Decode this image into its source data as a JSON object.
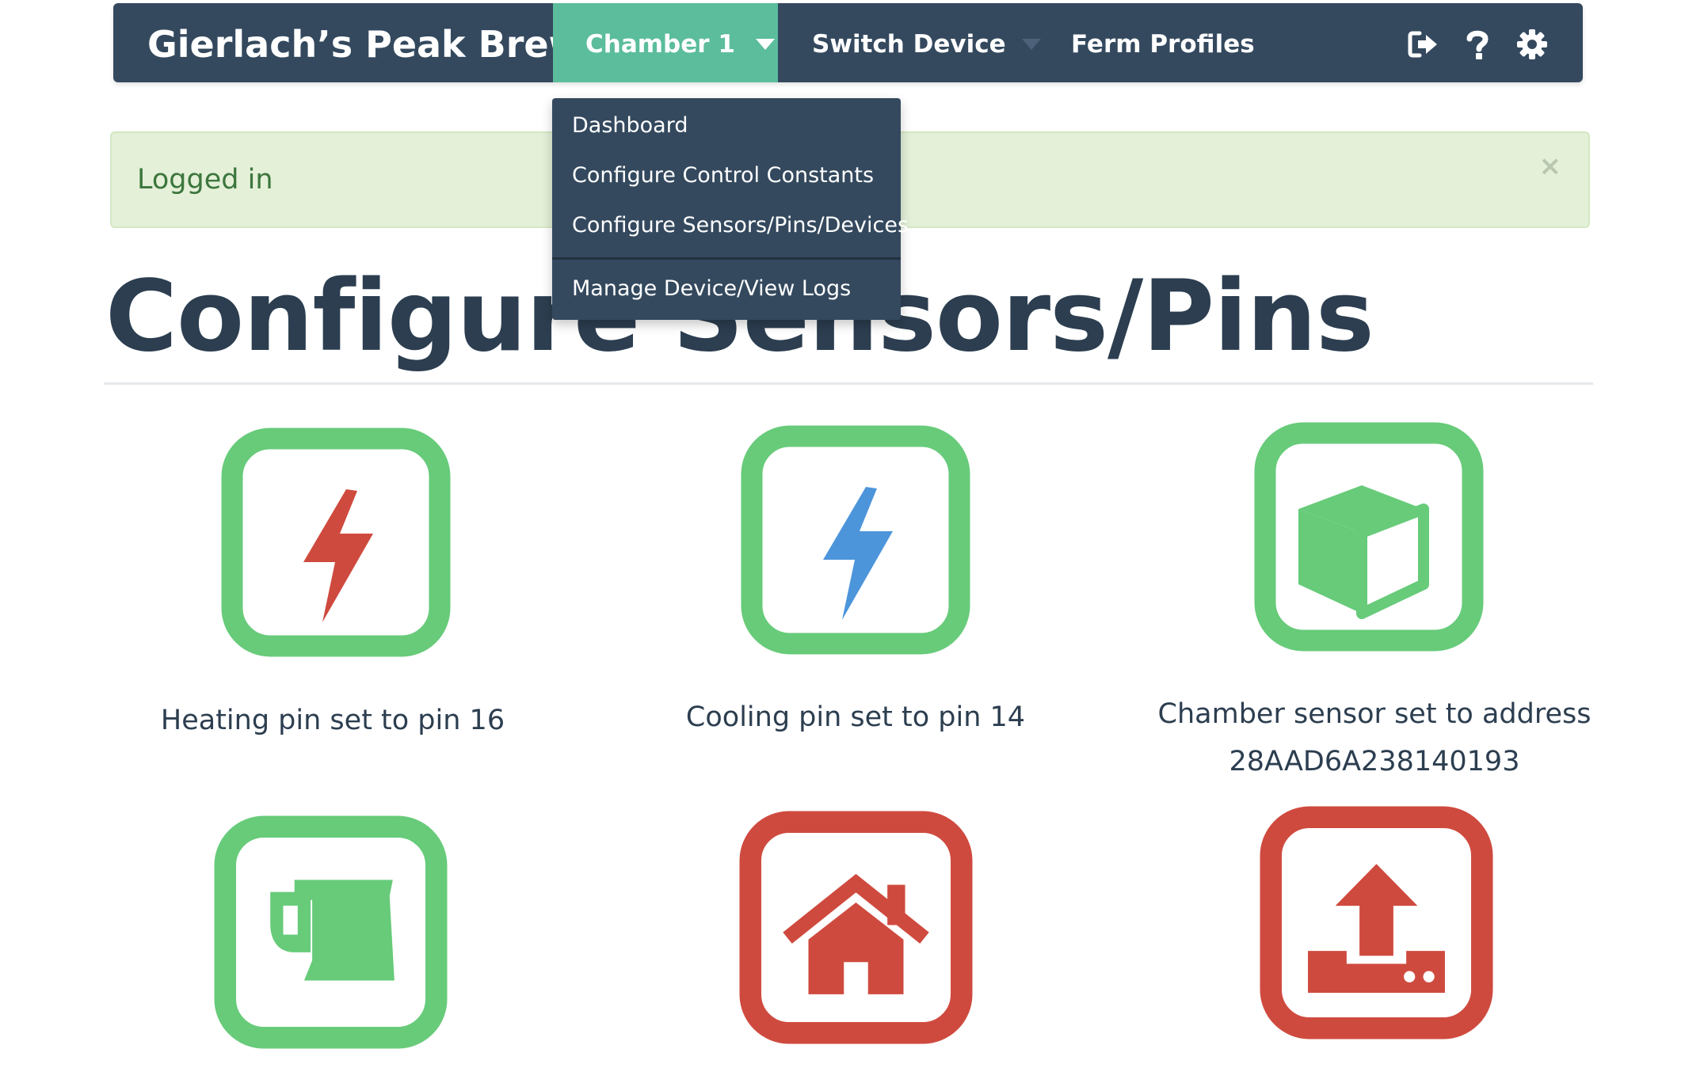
{
  "navbar": {
    "brand": "Gierlach’s Peak Brewing",
    "active_device": "Chamber 1",
    "switch_device": "Switch Device",
    "ferm_profiles": "Ferm Profiles",
    "icons": [
      "logout-icon",
      "help-icon",
      "settings-gear-icon"
    ]
  },
  "alert": {
    "message": "Logged in",
    "close": "×"
  },
  "dropdown": {
    "items": [
      "Dashboard",
      "Configure Control Constants",
      "Configure Sensors/Pins/Devices",
      "Manage Device/View Logs"
    ]
  },
  "page": {
    "title": "Configure Sensors/Pins"
  },
  "tiles": [
    {
      "icon": "bolt-icon",
      "status": "configured",
      "label": "Heating pin set to pin 16",
      "label2": ""
    },
    {
      "icon": "bolt-icon",
      "status": "configured",
      "label": "Cooling pin set to pin 14",
      "label2": ""
    },
    {
      "icon": "cube-icon",
      "status": "configured",
      "label": "Chamber sensor set to address",
      "label2": "28AAD6A238140193"
    },
    {
      "icon": "beer-mug-icon",
      "status": "configured"
    },
    {
      "icon": "home-icon",
      "status": "not-configured"
    },
    {
      "icon": "upload-icon",
      "status": "not-configured"
    }
  ],
  "colors": {
    "navbar": "#34495e",
    "active_tab": "#5bbd9c",
    "configured": "#67cb7a",
    "not_configured": "#cf4a3e",
    "heating_bolt": "#cf4a3e",
    "cooling_bolt": "#4d95db",
    "alert_bg": "#e4f0d8",
    "alert_text": "#3c763d"
  }
}
